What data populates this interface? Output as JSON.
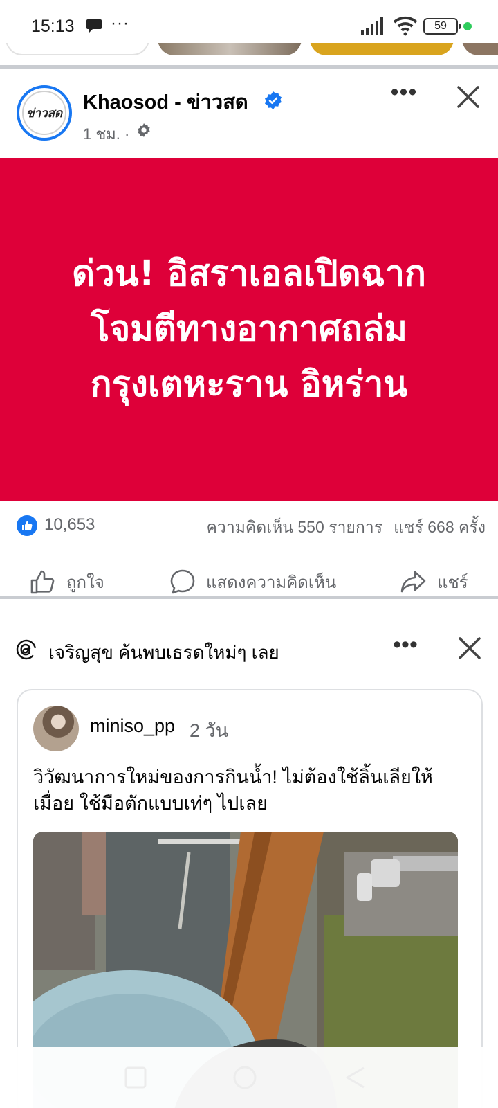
{
  "status_bar": {
    "time": "15:13",
    "battery": "59",
    "more_indicator": "···"
  },
  "post": {
    "page_name": "Khaosod - ข่าวสด",
    "avatar_text": "ข่าวสด",
    "time": "1 ชม. ·",
    "more": "•••",
    "headline_lines": [
      "ด่วน! อิสราเอลเปิดฉาก",
      "โจมตีทางอากาศถล่ม",
      "กรุงเตหะราน อิหร่าน"
    ],
    "likes": "10,653",
    "comments": "ความคิดเห็น 550 รายการ",
    "shares": "แชร์ 668 ครั้ง",
    "actions": {
      "like": "ถูกใจ",
      "comment": "แสดงความคิดเห็น",
      "share": "แชร์"
    }
  },
  "suggestion": {
    "text": "เจริญสุข ค้นพบเธรดใหม่ๆ เลย",
    "more": "•••",
    "thread": {
      "username": "miniso_pp",
      "age": "2 วัน",
      "caption": "วิวัฒนาการใหม่ของการกินน้ำ! ไม่ต้องใช้ลิ้นเลียให้เมื่อย ใช้มือตักแบบเท่ๆ ไปเลย"
    }
  },
  "colors": {
    "brand_blue": "#1877f2",
    "news_red": "#de0039",
    "secondary_text": "#65676b"
  }
}
